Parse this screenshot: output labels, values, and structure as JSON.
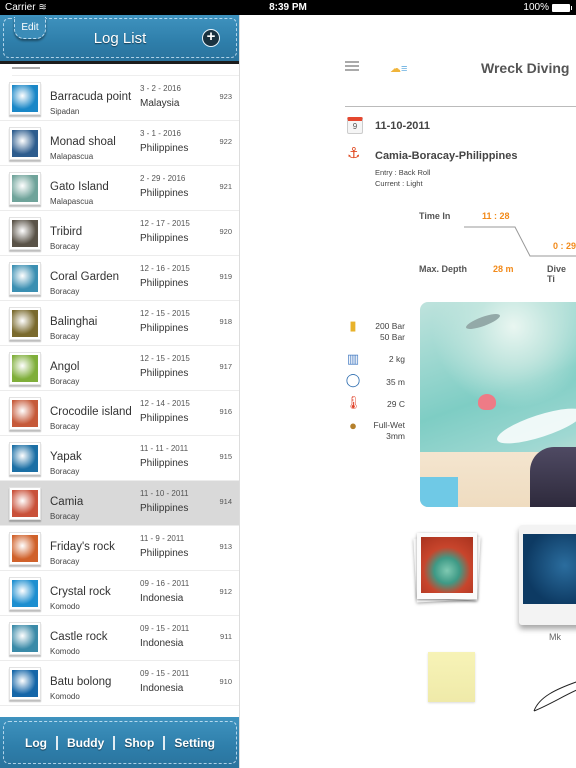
{
  "status_bar": {
    "carrier": "Carrier",
    "time": "8:39 PM",
    "battery": "100%"
  },
  "header": {
    "edit_label": "Edit",
    "title": "Log List",
    "add_label": "+"
  },
  "log_list": [
    {
      "name": "Barracuda point",
      "site": "Sipadan",
      "date": "3 - 2 - 2016",
      "country": "Malaysia",
      "number": "923",
      "thumb_color": "#1a87c7",
      "selected": false
    },
    {
      "name": "Monad shoal",
      "site": "Malapascua",
      "date": "3 - 1 - 2016",
      "country": "Philippines",
      "number": "922",
      "thumb_color": "#2e5d8e",
      "selected": false
    },
    {
      "name": "Gato Island",
      "site": "Malapascua",
      "date": "2 - 29 - 2016",
      "country": "Philippines",
      "number": "921",
      "thumb_color": "#6fa39a",
      "selected": false
    },
    {
      "name": "Tribird",
      "site": "Boracay",
      "date": "12 - 17 - 2015",
      "country": "Philippines",
      "number": "920",
      "thumb_color": "#5a5348",
      "selected": false
    },
    {
      "name": "Coral Garden",
      "site": "Boracay",
      "date": "12 - 16 - 2015",
      "country": "Philippines",
      "number": "919",
      "thumb_color": "#3b8fb2",
      "selected": false
    },
    {
      "name": "Balinghai",
      "site": "Boracay",
      "date": "12 - 15 - 2015",
      "country": "Philippines",
      "number": "918",
      "thumb_color": "#7a6a2e",
      "selected": false
    },
    {
      "name": "Angol",
      "site": "Boracay",
      "date": "12 - 15 - 2015",
      "country": "Philippines",
      "number": "917",
      "thumb_color": "#7fae3a",
      "selected": false
    },
    {
      "name": "Crocodile island",
      "site": "Boracay",
      "date": "12 - 14 - 2015",
      "country": "Philippines",
      "number": "916",
      "thumb_color": "#c65a3a",
      "selected": false
    },
    {
      "name": "Yapak",
      "site": "Boracay",
      "date": "11 - 11 - 2011",
      "country": "Philippines",
      "number": "915",
      "thumb_color": "#1b6fa5",
      "selected": false
    },
    {
      "name": "Camia",
      "site": "Boracay",
      "date": "11 - 10 - 2011",
      "country": "Philippines",
      "number": "914",
      "thumb_color": "#c9513a",
      "selected": true
    },
    {
      "name": "Friday's rock",
      "site": "Boracay",
      "date": "11 - 9 - 2011",
      "country": "Philippines",
      "number": "913",
      "thumb_color": "#d0612a",
      "selected": false
    },
    {
      "name": "Crystal rock",
      "site": "Komodo",
      "date": "09 - 16 - 2011",
      "country": "Indonesia",
      "number": "912",
      "thumb_color": "#1e8fd0",
      "selected": false
    },
    {
      "name": "Castle rock",
      "site": "Komodo",
      "date": "09 - 15 - 2011",
      "country": "Indonesia",
      "number": "911",
      "thumb_color": "#3a8aa8",
      "selected": false
    },
    {
      "name": "Batu bolong",
      "site": "Komodo",
      "date": "09 - 15 - 2011",
      "country": "Indonesia",
      "number": "910",
      "thumb_color": "#1566a8",
      "selected": false
    }
  ],
  "tab_bar": {
    "tabs": [
      "Log",
      "Buddy",
      "Shop",
      "Setting"
    ]
  },
  "detail": {
    "title": "Wreck Diving",
    "date": "11-10-2011",
    "site": "Camia-Boracay-Philippines",
    "entry": "Entry : Back Roll",
    "current": "Current : Light",
    "time_in_label": "Time In",
    "time_in": "11 : 28",
    "dive_time": "0 : 29",
    "max_depth_label": "Max. Depth",
    "max_depth": "28 m",
    "dive_time_label": "Dive Ti",
    "equipment": {
      "tank_start": "200 Bar",
      "tank_end": "50 Bar",
      "weight": "2 kg",
      "visibility": "35 m",
      "temperature": "29 C",
      "suit": "Full-Wet",
      "suit_thickness": "3mm"
    },
    "photo_caption": "Mk"
  }
}
